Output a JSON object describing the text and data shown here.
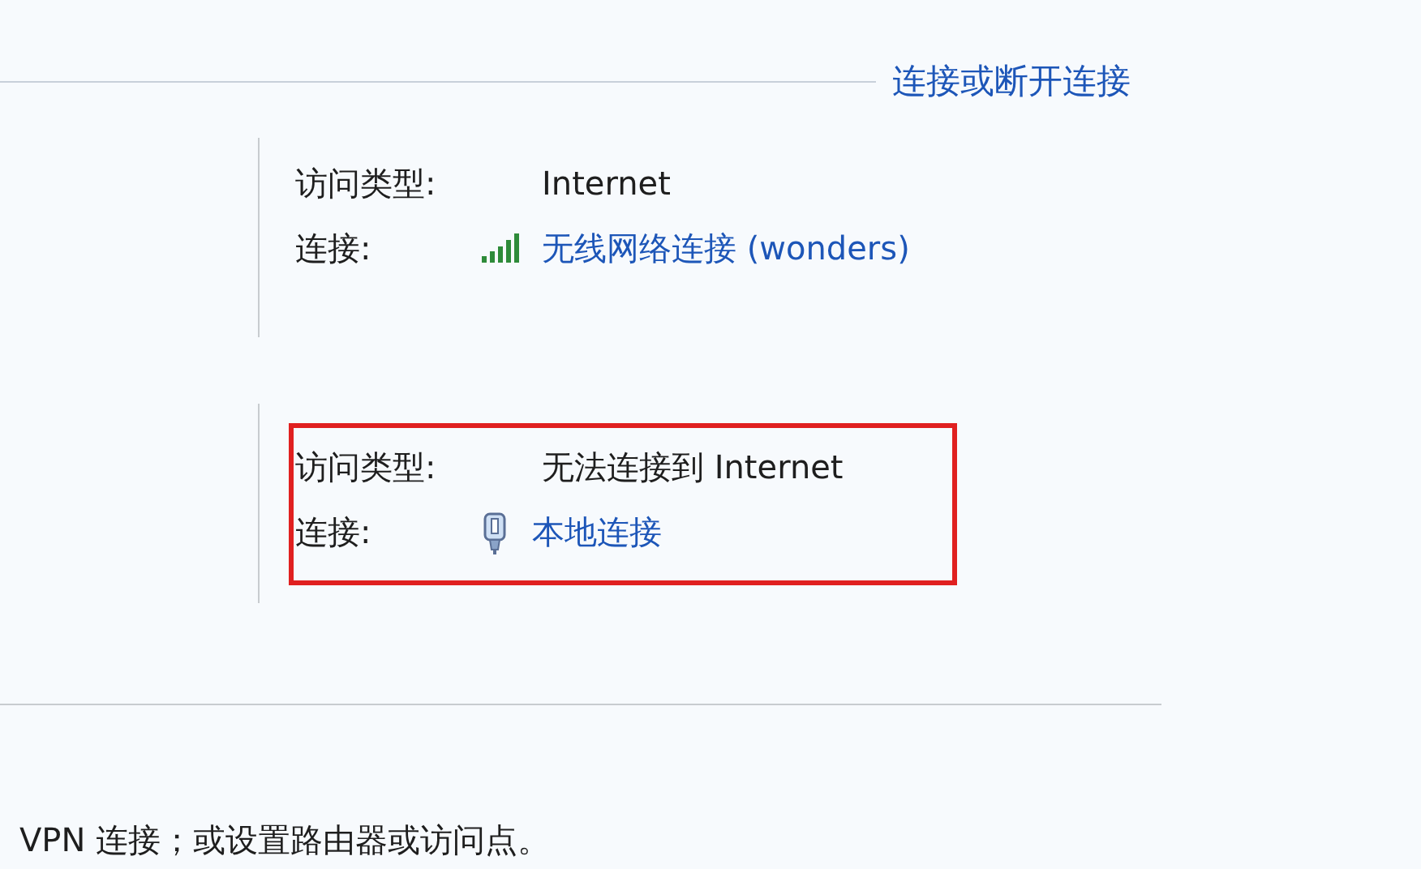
{
  "header_link": "连接或断开连接",
  "networks": [
    {
      "access_label": "访问类型:",
      "access_value": "Internet",
      "connection_label": "连接:",
      "kind": "wireless",
      "connection_name": "无线网络连接 (wonders)",
      "highlighted": false
    },
    {
      "access_label": "访问类型:",
      "access_value": "无法连接到 Internet",
      "connection_label": "连接:",
      "kind": "wired",
      "connection_name": "本地连接",
      "highlighted": true
    }
  ],
  "footer_text": "VPN 连接；或设置路由器或访问点。"
}
